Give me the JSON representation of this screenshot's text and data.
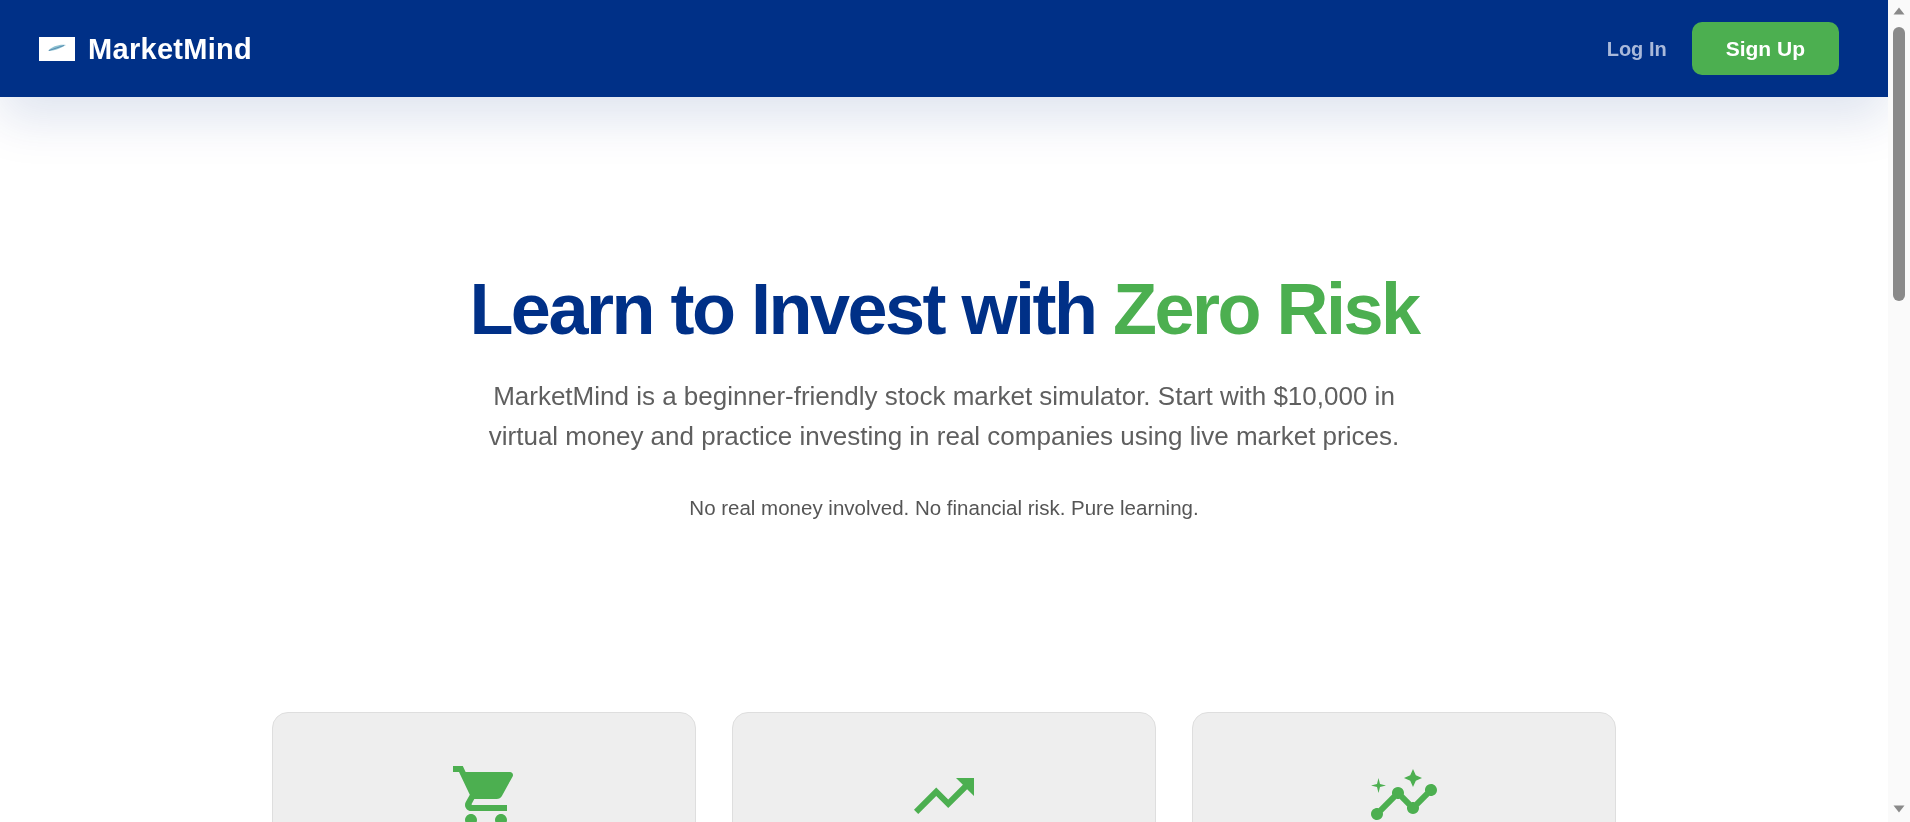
{
  "header": {
    "brand": "MarketMind",
    "nav": [
      {
        "kind": "link",
        "label": "Log In"
      },
      {
        "kind": "button",
        "label": "Sign Up"
      }
    ]
  },
  "hero": {
    "title": {
      "text": "Learn to Invest with",
      "highlight": "Zero Risk"
    },
    "description": "MarketMind is a beginner-friendly stock market simulator. Start with $10,000 in virtual money and practice investing in real companies using live market prices.",
    "note": "No real money involved. No financial risk. Pure learning."
  },
  "features": [
    {
      "kind": "cart"
    },
    {
      "kind": "trend"
    },
    {
      "kind": "insights"
    }
  ]
}
